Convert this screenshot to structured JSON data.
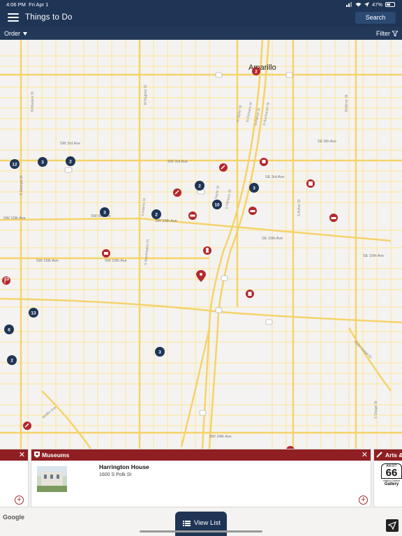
{
  "status": {
    "time": "4:06 PM",
    "date": "Fri Apr 1",
    "battery": "47%"
  },
  "nav": {
    "title": "Things to Do",
    "search_label": "Search"
  },
  "toolbar": {
    "order_label": "Order",
    "filter_label": "Filter"
  },
  "map": {
    "city_label": "Amarillo",
    "street_labels": [
      "SW 3rd Ave",
      "SW 6th Ave",
      "SW 10th Ave",
      "SW 15th Ave",
      "SE 3rd Ave",
      "SE 10th Ave",
      "SE 6th Ave",
      "SW 34th Ave",
      "SE 34th Ave",
      "N Taylor St",
      "N Fillmore St",
      "N Pierce St",
      "N Buchanan St",
      "S Taylor St",
      "S Fillmore St",
      "S Washington St",
      "S Adams St",
      "S Georgia St",
      "S Arthur St",
      "N Mirror St",
      "N Hughes St",
      "N Western St",
      "N Masters St",
      "Ross Osage Dr",
      "S Osage St",
      "Wolflin Ave",
      "SE 15th Ave"
    ],
    "cluster_counts": [
      "2",
      "12",
      "3",
      "2",
      "2",
      "3",
      "10",
      "3",
      "2",
      "13",
      "6",
      "2",
      "3"
    ],
    "highway_labels": [
      "40",
      "40",
      "40",
      "40",
      "287",
      "87",
      "27",
      "40",
      "40",
      "287"
    ]
  },
  "cards": {
    "left": {
      "close": "✕"
    },
    "main": {
      "category": "Museums",
      "close": "✕",
      "name": "Harrington House",
      "address": "1600 S Polk St",
      "add": "+"
    },
    "right": {
      "category": "Arts &",
      "logo_top": "AM RT",
      "logo_num": "66",
      "logo_sub": "Visitor Center",
      "logo_bottom": "Gallery"
    }
  },
  "bottom": {
    "view_list_label": "View List",
    "google": "Google"
  },
  "colors": {
    "navy": "#1f3556",
    "maroon": "#8f1f22",
    "road_major": "#f5d36b",
    "road_minor": "#fbe7a6",
    "cluster": "#1f3556",
    "poi": "#b3282d"
  }
}
